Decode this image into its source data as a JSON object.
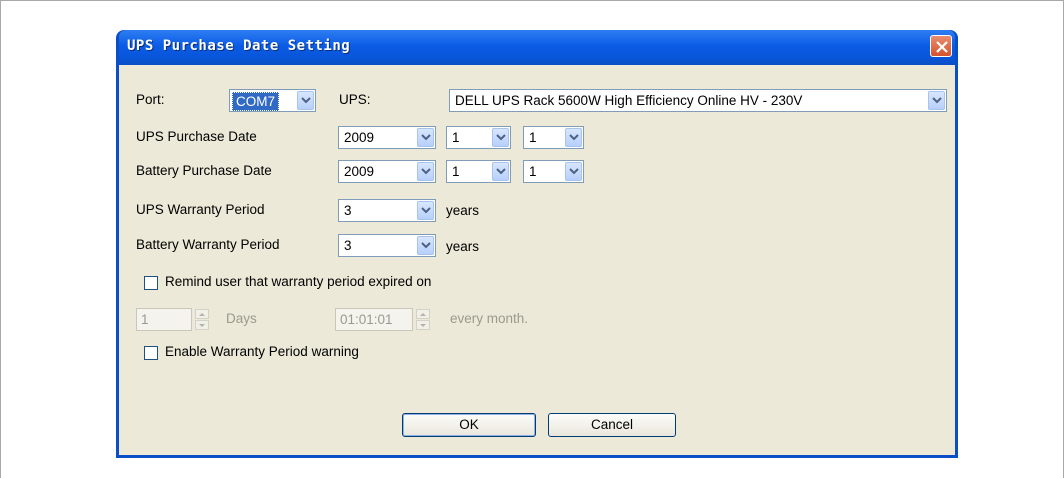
{
  "dialog": {
    "title": "UPS Purchase Date Setting"
  },
  "port": {
    "label": "Port:",
    "value": "COM7"
  },
  "ups": {
    "label": "UPS:",
    "value": "DELL UPS Rack 5600W High Efficiency Online HV - 230V"
  },
  "ups_purchase_date": {
    "label": "UPS Purchase Date",
    "year": "2009",
    "month": "1",
    "day": "1"
  },
  "battery_purchase_date": {
    "label": "Battery Purchase Date",
    "year": "2009",
    "month": "1",
    "day": "1"
  },
  "ups_warranty": {
    "label": "UPS Warranty Period",
    "value": "3",
    "unit": "years"
  },
  "battery_warranty": {
    "label": "Battery Warranty Period",
    "value": "3",
    "unit": "years"
  },
  "remind": {
    "label": "Remind user that warranty period expired on",
    "checked": false,
    "days_value": "1",
    "days_label": "Days",
    "time_value": "01:01:01",
    "time_suffix": "every month."
  },
  "enable_warning": {
    "label": "Enable Warranty Period warning",
    "checked": false
  },
  "buttons": {
    "ok": "OK",
    "cancel": "Cancel"
  },
  "colors": {
    "titlebar": "#0a4fc5",
    "dialog_bg": "#ece9d8",
    "selection": "#316ac5",
    "close_button": "#d4532b"
  }
}
